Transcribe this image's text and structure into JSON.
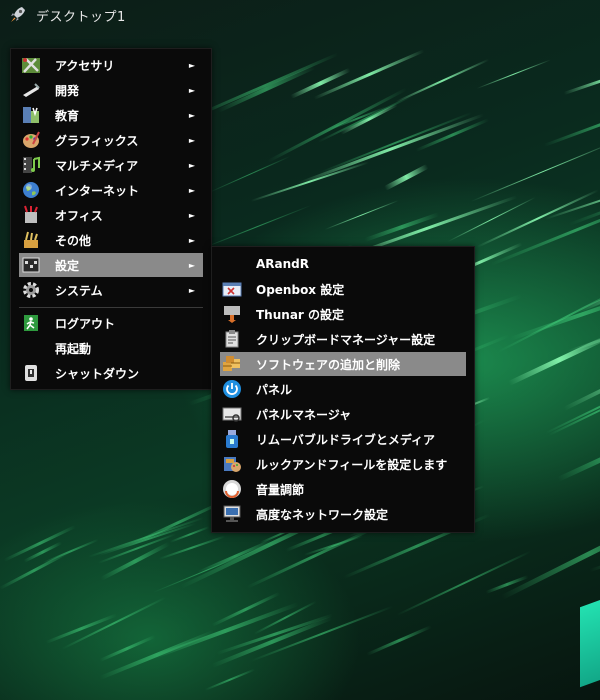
{
  "topbar": {
    "title": "デスクトップ1",
    "icon": "rocket-icon"
  },
  "main_menu": {
    "items": [
      {
        "label": "アクセサリ",
        "icon": "accessories-icon",
        "submenu": true
      },
      {
        "label": "開発",
        "icon": "development-icon",
        "submenu": true
      },
      {
        "label": "教育",
        "icon": "education-icon",
        "submenu": true
      },
      {
        "label": "グラフィックス",
        "icon": "graphics-icon",
        "submenu": true
      },
      {
        "label": "マルチメディア",
        "icon": "multimedia-icon",
        "submenu": true
      },
      {
        "label": "インターネット",
        "icon": "internet-globe-icon",
        "submenu": true
      },
      {
        "label": "オフィス",
        "icon": "office-icon",
        "submenu": true
      },
      {
        "label": "その他",
        "icon": "other-icon",
        "submenu": true
      },
      {
        "label": "設定",
        "icon": "settings-icon",
        "submenu": true,
        "selected": true
      },
      {
        "label": "システム",
        "icon": "system-gear-icon",
        "submenu": true
      }
    ],
    "actions": [
      {
        "label": "ログアウト",
        "icon": "logout-icon"
      },
      {
        "label": "再起動",
        "icon": ""
      },
      {
        "label": "シャットダウン",
        "icon": "shutdown-icon"
      }
    ],
    "arrow": "►"
  },
  "settings_submenu": {
    "items": [
      {
        "label": "ARandR",
        "icon": ""
      },
      {
        "label": "Openbox 設定",
        "icon": "openbox-settings-icon"
      },
      {
        "label": "Thunar の設定",
        "icon": "thunar-settings-icon"
      },
      {
        "label": "クリップボードマネージャー設定",
        "icon": "clipboard-icon"
      },
      {
        "label": "ソフトウェアの追加と削除",
        "icon": "software-package-icon",
        "selected": true
      },
      {
        "label": "パネル",
        "icon": "panel-power-icon"
      },
      {
        "label": "パネルマネージャ",
        "icon": "panel-manager-icon"
      },
      {
        "label": "リムーバブルドライブとメディア",
        "icon": "usb-drive-icon"
      },
      {
        "label": "ルックアンドフィールを設定します",
        "icon": "appearance-icon"
      },
      {
        "label": "音量調節",
        "icon": "volume-icon"
      },
      {
        "label": "高度なネットワーク設定",
        "icon": "network-icon"
      }
    ]
  },
  "colors": {
    "menu_bg": "#0a0a0a",
    "selection": "#8a8a8a",
    "text": "#ffffff"
  }
}
